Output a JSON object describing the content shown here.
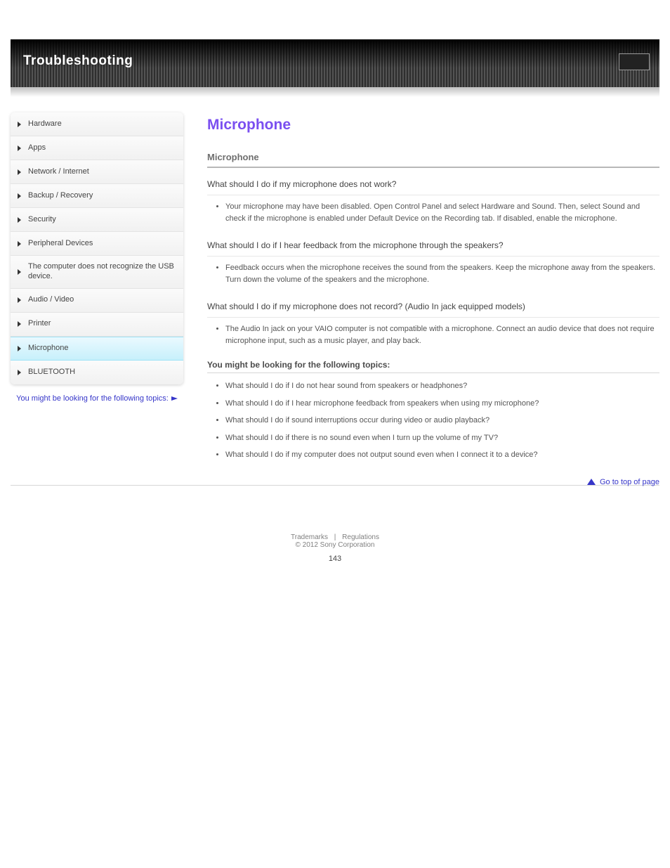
{
  "header": {
    "title": "Troubleshooting"
  },
  "sidebar": {
    "items": [
      {
        "label": "Hardware"
      },
      {
        "label": "Apps"
      },
      {
        "label": "Network / Internet"
      },
      {
        "label": "Backup / Recovery"
      },
      {
        "label": "Security"
      },
      {
        "label": "Peripheral Devices"
      },
      {
        "label": "The computer does not recognize the USB device."
      },
      {
        "label": "Audio / Video"
      },
      {
        "label": "Printer"
      },
      {
        "label": "Microphone"
      },
      {
        "label": "BLUETOOTH"
      }
    ],
    "active_index": 9
  },
  "external_link": {
    "text": "You might be looking for the following topics:"
  },
  "content": {
    "title": "Microphone",
    "sub_heading": "Microphone",
    "defs": [
      {
        "dt": "What should I do if my microphone does not work?",
        "items": [
          "Your microphone may have been disabled. Open Control Panel and select Hardware and Sound. Then, select Sound and check if the microphone is enabled under Default Device on the Recording tab. If disabled, enable the microphone."
        ]
      },
      {
        "dt": "What should I do if I hear feedback from the microphone through the speakers?",
        "items": [
          "Feedback occurs when the microphone receives the sound from the speakers. Keep the microphone away from the speakers. Turn down the volume of the speakers and the microphone."
        ]
      },
      {
        "dt": "What should I do if my microphone does not record? (Audio In jack equipped models)",
        "items": [
          "The Audio In jack on your VAIO computer is not compatible with a microphone. Connect an audio device that does not require microphone input, such as a music player, and play back."
        ]
      }
    ],
    "related_heading": "You might be looking for the following topics:",
    "related": [
      "What should I do if I do not hear sound from speakers or headphones?",
      "What should I do if I hear microphone feedback from speakers when using my microphone?",
      "What should I do if sound interruptions occur during video or audio playback?",
      "What should I do if there is no sound even when I turn up the volume of my TV?",
      "What should I do if my computer does not output sound even when I connect it to a device?"
    ]
  },
  "back_to_top": "Go to top of page",
  "footer": {
    "links": [
      "Trademarks",
      "Regulations"
    ],
    "copyright": "© 2012 Sony Corporation"
  },
  "page_number": "143"
}
